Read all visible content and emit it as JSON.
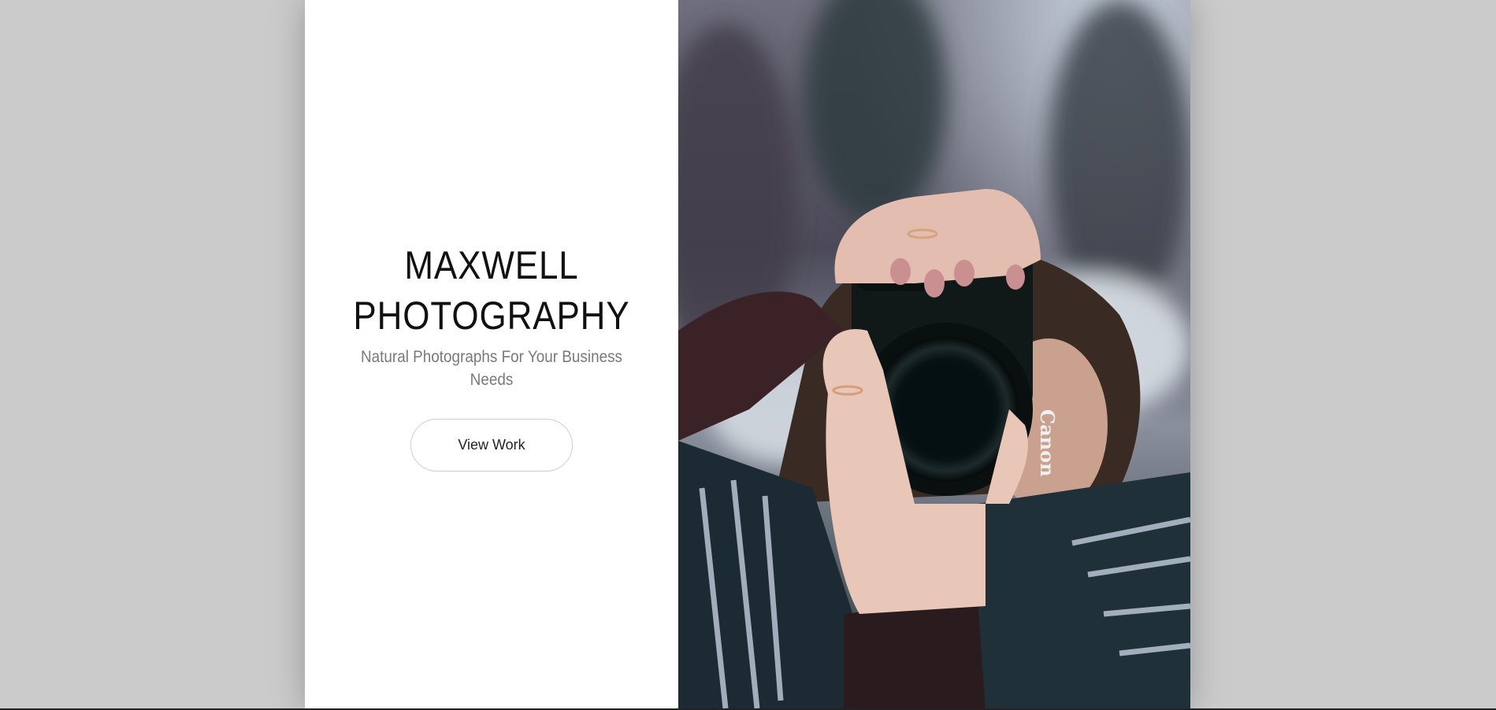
{
  "hero": {
    "title_line1": "MAXWELL",
    "title_line2": "PHOTOGRAPHY",
    "subtitle": "Natural Photographs For Your Business Needs",
    "button_label": "View Work"
  },
  "photo": {
    "subject": "person-holding-camera-photo",
    "lens_text_brand": "Canon"
  },
  "colors": {
    "background": "#cbcbcb",
    "panel": "#ffffff",
    "title": "#111111",
    "subtitle": "#7a7a7a"
  }
}
